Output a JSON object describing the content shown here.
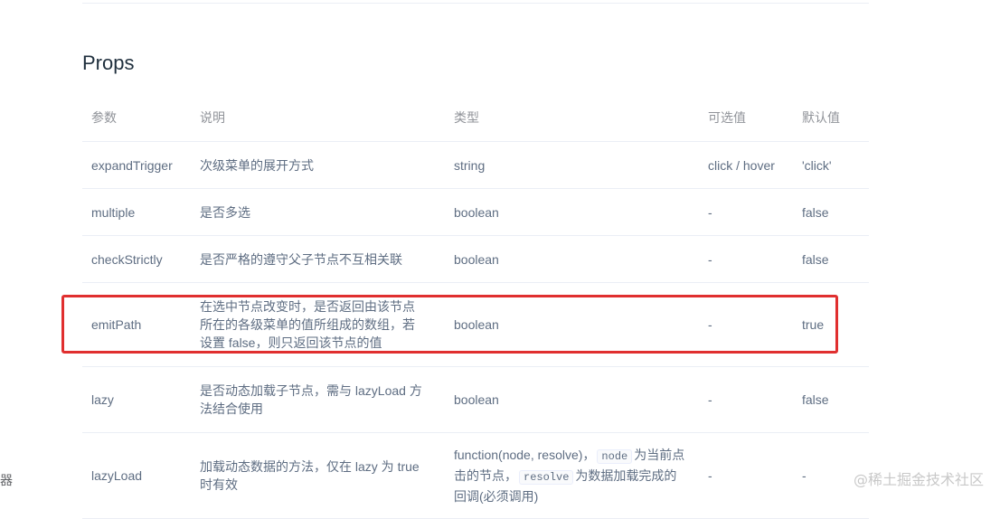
{
  "section": {
    "title": "Props"
  },
  "table": {
    "headers": [
      "参数",
      "说明",
      "类型",
      "可选值",
      "默认值"
    ],
    "rows": [
      {
        "param": "expandTrigger",
        "desc": "次级菜单的展开方式",
        "type": "string",
        "options": "click / hover",
        "default": "'click'"
      },
      {
        "param": "multiple",
        "desc": "是否多选",
        "type": "boolean",
        "options": "-",
        "default": "false"
      },
      {
        "param": "checkStrictly",
        "desc": "是否严格的遵守父子节点不互相关联",
        "type": "boolean",
        "options": "-",
        "default": "false"
      },
      {
        "param": "emitPath",
        "desc_line1": "在选中节点改变时，是否返回由该节点",
        "desc_line2": "所在的各级菜单的值所组成的数组，若",
        "desc_line3": "设置 false，则只返回该节点的值",
        "type": "boolean",
        "options": "-",
        "default": "true"
      },
      {
        "param": "lazy",
        "desc_line1": "是否动态加载子节点，需与 lazyLoad 方",
        "desc_line2": "法结合使用",
        "type": "boolean",
        "options": "-",
        "default": "false"
      },
      {
        "param": "lazyLoad",
        "desc_line1": "加载动态数据的方法，仅在 lazy 为 true",
        "desc_line2": "时有效",
        "type_line1": "function(node, resolve)，",
        "type_code1": "node",
        "type_text1": "为当前点",
        "type_line2": "击的节点，",
        "type_code2": "resolve",
        "type_text2": "为数据加载完成的",
        "type_line3": "回调(必须调用)",
        "options": "-",
        "default": "-"
      }
    ]
  },
  "edge_text": "器",
  "watermark": "@稀土掘金技术社区",
  "highlight_color": "#e02f2f"
}
